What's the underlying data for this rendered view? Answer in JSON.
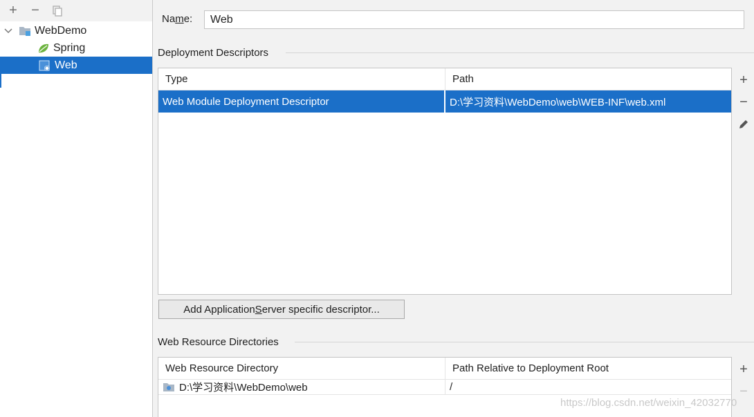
{
  "toolbar": {
    "add": "+",
    "remove": "−",
    "copy": "⧉"
  },
  "tree": {
    "root": "WebDemo",
    "children": [
      {
        "label": "Spring",
        "icon": "spring-leaf-icon"
      },
      {
        "label": "Web",
        "icon": "web-facet-icon",
        "selected": true
      }
    ]
  },
  "name": {
    "label_pre": "Na",
    "label_underlined": "m",
    "label_post": "e:",
    "value": "Web"
  },
  "deployment": {
    "title": "Deployment Descriptors",
    "columns": [
      "Type",
      "Path"
    ],
    "rows": [
      {
        "type": "Web Module Deployment Descriptor",
        "path": "D:\\学习资料\\WebDemo\\web\\WEB-INF\\web.xml"
      }
    ],
    "add_button_pre": "Add Application ",
    "add_button_underlined": "S",
    "add_button_post": "erver specific descriptor..."
  },
  "resources": {
    "title": "Web Resource Directories",
    "columns": [
      "Web Resource Directory",
      "Path Relative to Deployment Root"
    ],
    "rows": [
      {
        "directory": "D:\\学习资料\\WebDemo\\web",
        "path": "/"
      }
    ]
  },
  "side_tools": {
    "add": "+",
    "remove": "−"
  },
  "watermark": "https://blog.csdn.net/weixin_42032770",
  "colors": {
    "selection": "#1b6fc8",
    "background": "#f2f2f2"
  }
}
